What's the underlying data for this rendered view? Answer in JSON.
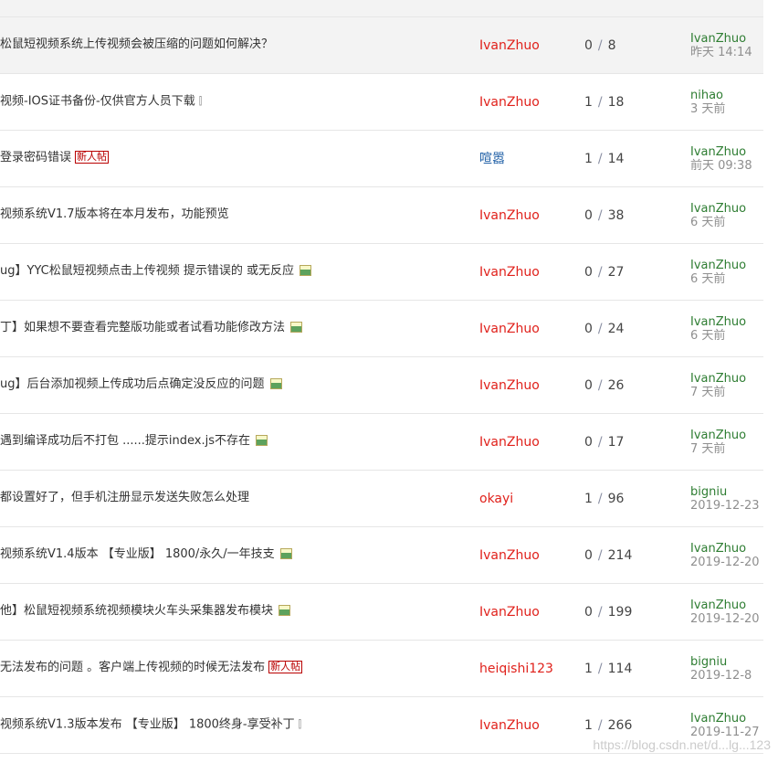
{
  "threads": [
    {
      "title": "松鼠短视频系统上传视频会被压缩的问题如何解决？",
      "icon": "none",
      "author": "IvanZhuo",
      "author_color": "#e0211b",
      "replies": "0",
      "views": "8",
      "last_user": "IvanZhuo",
      "last_time": "昨天 14:14"
    },
    {
      "title": "视频-IOS证书备份-仅供官方人员下载",
      "icon": "attachment-icon",
      "author": "IvanZhuo",
      "author_color": "#e0211b",
      "replies": "1",
      "views": "18",
      "last_user": "nihao",
      "last_time": "3 天前"
    },
    {
      "title": "登录密码错误",
      "icon": "new-post-badge",
      "badge": "新人帖",
      "author": "喧嚣",
      "author_color": "#1f5fa6",
      "replies": "1",
      "views": "14",
      "last_user": "IvanZhuo",
      "last_time": "前天 09:38"
    },
    {
      "title": "视频系统V1.7版本将在本月发布，功能预览",
      "icon": "none",
      "author": "IvanZhuo",
      "author_color": "#e0211b",
      "replies": "0",
      "views": "38",
      "last_user": "IvanZhuo",
      "last_time": "6 天前"
    },
    {
      "title": "ug】YYC松鼠短视频点击上传视频 提示错误的 或无反应",
      "icon": "image-icon",
      "author": "IvanZhuo",
      "author_color": "#e0211b",
      "replies": "0",
      "views": "27",
      "last_user": "IvanZhuo",
      "last_time": "6 天前"
    },
    {
      "title": "丁】如果想不要查看完整版功能或者试看功能修改方法",
      "icon": "image-icon",
      "author": "IvanZhuo",
      "author_color": "#e0211b",
      "replies": "0",
      "views": "24",
      "last_user": "IvanZhuo",
      "last_time": "6 天前"
    },
    {
      "title": "ug】后台添加视频上传成功后点确定没反应的问题",
      "icon": "image-icon",
      "author": "IvanZhuo",
      "author_color": "#e0211b",
      "replies": "0",
      "views": "26",
      "last_user": "IvanZhuo",
      "last_time": "7 天前"
    },
    {
      "title": "遇到编译成功后不打包 ......提示index.js不存在",
      "icon": "image-icon",
      "author": "IvanZhuo",
      "author_color": "#e0211b",
      "replies": "0",
      "views": "17",
      "last_user": "IvanZhuo",
      "last_time": "7 天前"
    },
    {
      "title": "都设置好了，但手机注册显示发送失败怎么处理",
      "icon": "none",
      "author": "okayi",
      "author_color": "#e0211b",
      "replies": "1",
      "views": "96",
      "last_user": "bigniu",
      "last_time": "2019-12-23"
    },
    {
      "title": "视频系统V1.4版本 【专业版】 1800/永久/一年技支",
      "icon": "image-icon",
      "author": "IvanZhuo",
      "author_color": "#e0211b",
      "replies": "0",
      "views": "214",
      "last_user": "IvanZhuo",
      "last_time": "2019-12-20"
    },
    {
      "title": "他】松鼠短视频系统视频模块火车头采集器发布模块",
      "icon": "image-icon",
      "author": "IvanZhuo",
      "author_color": "#e0211b",
      "replies": "0",
      "views": "199",
      "last_user": "IvanZhuo",
      "last_time": "2019-12-20"
    },
    {
      "title": "无法发布的问题 。客户端上传视频的时候无法发布",
      "icon": "new-post-badge",
      "badge": "新人帖",
      "author": "heiqishi123",
      "author_color": "#e0211b",
      "replies": "1",
      "views": "114",
      "last_user": "bigniu",
      "last_time": "2019-12-8"
    },
    {
      "title": "视频系统V1.3版本发布 【专业版】 1800终身-享受补丁",
      "icon": "attachment-icon",
      "author": "IvanZhuo",
      "author_color": "#e0211b",
      "replies": "1",
      "views": "266",
      "last_user": "IvanZhuo",
      "last_time": "2019-11-27"
    }
  ],
  "count_separator": "/",
  "attachment_glyph": "⫿",
  "watermark": "https://blog.csdn.net/d...lg...123"
}
